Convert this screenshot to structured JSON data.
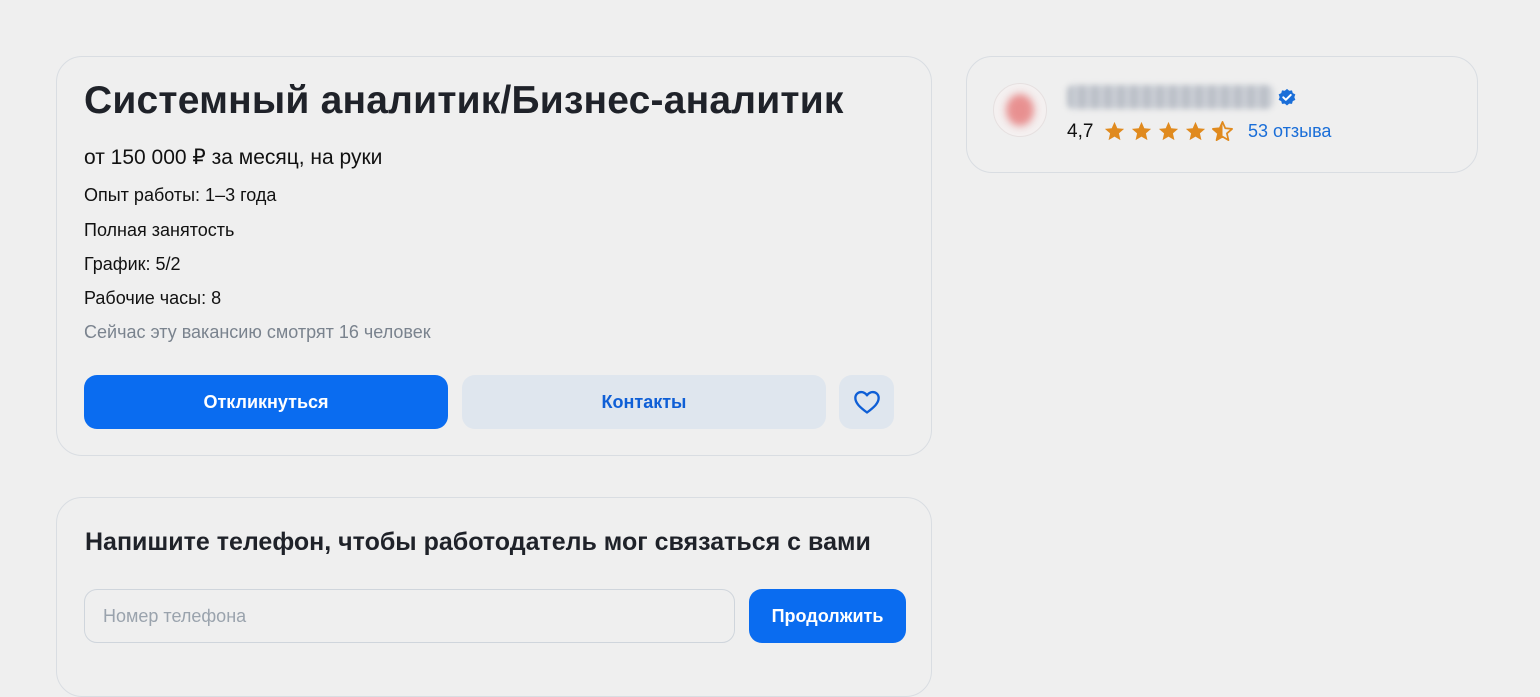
{
  "vacancy": {
    "title": "Системный аналитик/Бизнес-аналитик",
    "salary": "от 150 000 ₽ за месяц, на руки",
    "experience": "Опыт работы: 1–3 года",
    "employment": "Полная занятость",
    "schedule": "График: 5/2",
    "work_hours": "Рабочие часы: 8",
    "viewers": "Сейчас эту вакансию смотрят 16 человек",
    "respond_label": "Откликнуться",
    "contacts_label": "Контакты",
    "favorite_icon": "heart-icon"
  },
  "phone_form": {
    "title": "Напишите телефон, чтобы работодатель мог связаться с вами",
    "placeholder": "Номер телефона",
    "value": "",
    "continue_label": "Продолжить"
  },
  "company": {
    "verified_icon": "verified-badge-icon",
    "rating": "4,7",
    "rating_value": 4.7,
    "rating_max": 5,
    "reviews_label": "53 отзыва"
  },
  "colors": {
    "background": "#efefef",
    "primary": "#0a6cf0",
    "secondary_button": "#dfe6ee",
    "star": "#e08a1e",
    "link": "#1a6ed8"
  }
}
